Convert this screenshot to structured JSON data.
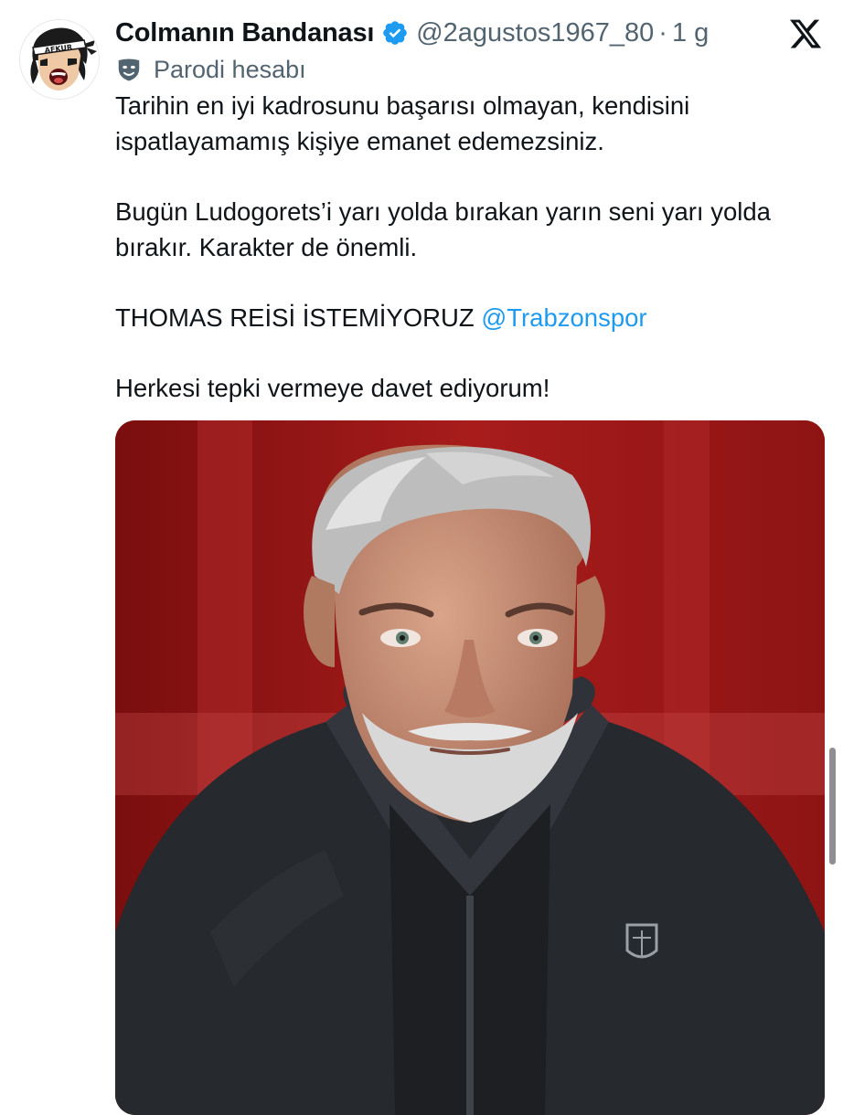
{
  "tweet": {
    "display_name": "Colmanın Bandanası",
    "handle": "@2agustos1967_80",
    "separator": "·",
    "time": "1 g",
    "parody_label": "Parodi hesabı",
    "lines": [
      "Tarihin en iyi kadrosunu başarısı olmayan, kendisini ispatlayamamış kişiye emanet edemezsiniz.",
      "Bugün Ludogorets’i yarı yolda bırakan yarın seni yarı yolda bırakır. Karakter de önemli."
    ],
    "caps_line": "THOMAS REİSİ İSTEMİYORUZ",
    "mention": "@Trabzonspor",
    "closing_line": "Herkesi tepki vermeye davet ediyorum!"
  },
  "avatar": {
    "headband_text": "AFKUR"
  },
  "colors": {
    "text": "#0f1419",
    "secondary": "#536471",
    "link": "#1d9bf0",
    "verified": "#1d9bf0",
    "background": "#ffffff"
  },
  "icons": {
    "verified": "verified-badge-icon",
    "platform": "x-logo-icon",
    "parody": "mask-icon"
  }
}
